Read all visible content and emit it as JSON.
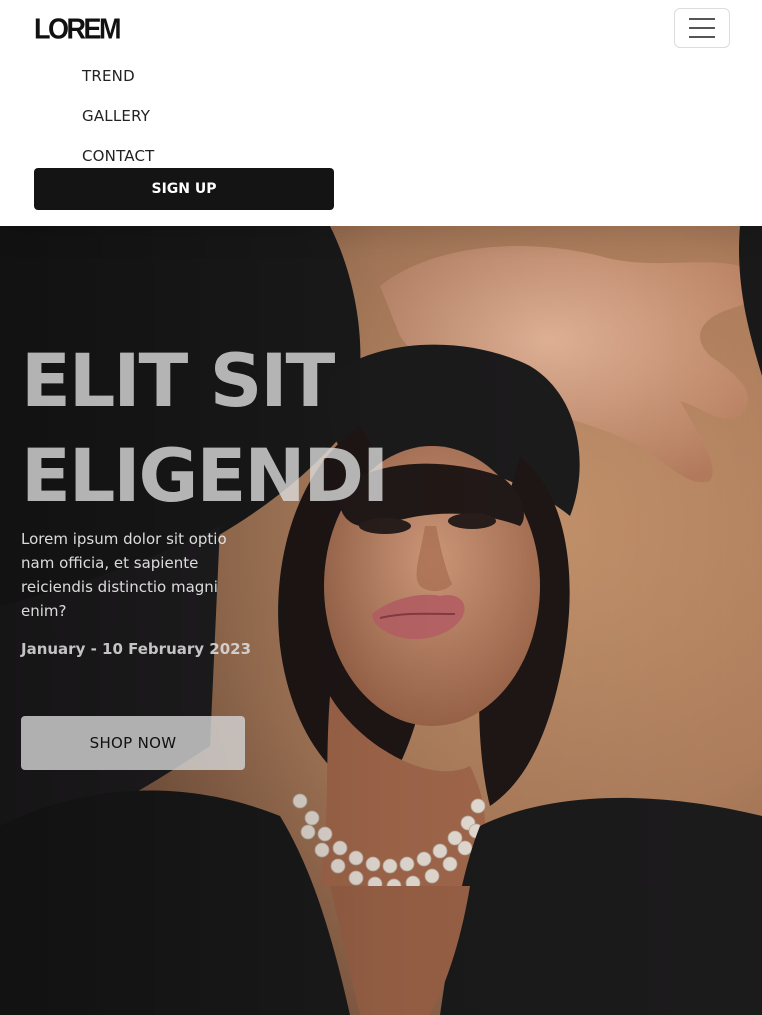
{
  "navbar": {
    "logo": "LOREM",
    "menu_toggle_icon": "hamburger-icon",
    "menu": [
      {
        "label": "TREND"
      },
      {
        "label": "GALLERY"
      },
      {
        "label": "CONTACT"
      }
    ],
    "signup_label": "SIGN UP"
  },
  "hero": {
    "title_line1": "ELIT SIT",
    "title_line2": "ELIGENDI",
    "description": "Lorem ipsum dolor sit optio nam officia, et sapiente reiciendis distinctio magni enim?",
    "date": "January - 10 February 2023",
    "cta_label": "SHOP NOW"
  },
  "colors": {
    "signup_bg": "#141414",
    "hero_backdrop": "#a8795a",
    "jacket": "#1c1b1c"
  }
}
